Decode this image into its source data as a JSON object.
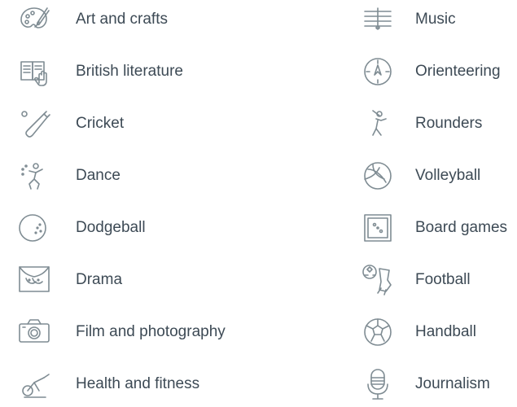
{
  "colors": {
    "text": "#3d4a55",
    "icon_stroke": "#7f8c93",
    "background": "#ffffff"
  },
  "subjects_left": [
    {
      "label": "Art and crafts",
      "icon": "palette-icon"
    },
    {
      "label": "British literature",
      "icon": "book-icon"
    },
    {
      "label": "Cricket",
      "icon": "cricket-bat-icon"
    },
    {
      "label": "Dance",
      "icon": "dancer-icon"
    },
    {
      "label": "Dodgeball",
      "icon": "ball-icon"
    },
    {
      "label": "Drama",
      "icon": "theatre-masks-icon"
    },
    {
      "label": "Film and photography",
      "icon": "camera-icon"
    },
    {
      "label": "Health and fitness",
      "icon": "exercise-bike-icon"
    }
  ],
  "subjects_right": [
    {
      "label": "Music",
      "icon": "music-staff-icon"
    },
    {
      "label": "Orienteering",
      "icon": "compass-icon"
    },
    {
      "label": "Rounders",
      "icon": "batter-icon"
    },
    {
      "label": "Volleyball",
      "icon": "volleyball-icon"
    },
    {
      "label": "Board games",
      "icon": "board-game-icon"
    },
    {
      "label": "Football",
      "icon": "football-boot-icon"
    },
    {
      "label": "Handball",
      "icon": "handball-icon"
    },
    {
      "label": "Journalism",
      "icon": "microphone-icon"
    }
  ]
}
